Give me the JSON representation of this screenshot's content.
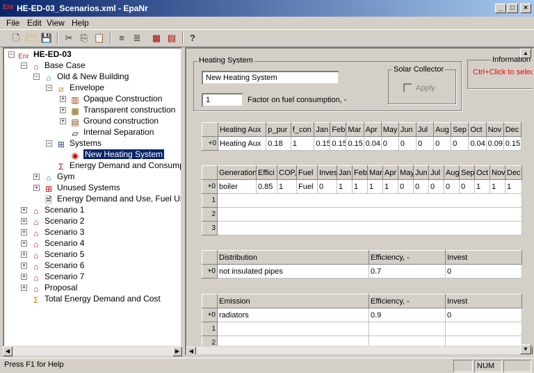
{
  "window": {
    "icon": "Enr",
    "title": "HE-ED-03_Scenarios.xml - EpaNr"
  },
  "menu": [
    "File",
    "Edit",
    "View",
    "Help"
  ],
  "tree": [
    {
      "label": "HE-ED-03",
      "icon": "Enr",
      "level": 0
    },
    {
      "label": "Base Case",
      "icon": "house-icon",
      "level": 1
    },
    {
      "label": "Old & New Building",
      "icon": "building-icon",
      "level": 2
    },
    {
      "label": "Envelope",
      "icon": "envelope-icon",
      "level": 3
    },
    {
      "label": "Opaque Construction",
      "icon": "wall-icon",
      "level": 4
    },
    {
      "label": "Transparent construction",
      "icon": "window-icon",
      "level": 4
    },
    {
      "label": "Ground construction",
      "icon": "ground-icon",
      "level": 4
    },
    {
      "label": "Internal Separation",
      "icon": "separation-icon",
      "level": 4
    },
    {
      "label": "Systems",
      "icon": "systems-icon",
      "level": 3
    },
    {
      "label": "New Heating System",
      "icon": "heating-icon",
      "level": 4
    },
    {
      "label": "Energy Demand and Consumption",
      "icon": "sum-icon",
      "level": 3
    },
    {
      "label": "Gym",
      "icon": "building-icon",
      "level": 2
    },
    {
      "label": "Unused Systems",
      "icon": "systems-icon",
      "level": 2
    },
    {
      "label": "Energy Demand and Use, Fuel Use",
      "icon": "doc-icon",
      "level": 2
    },
    {
      "label": "Scenario 1",
      "icon": "house-icon",
      "level": 1
    },
    {
      "label": "Scenario 2",
      "icon": "house-icon",
      "level": 1
    },
    {
      "label": "Scenario 3",
      "icon": "house-icon",
      "level": 1
    },
    {
      "label": "Scenario 4",
      "icon": "house-icon",
      "level": 1
    },
    {
      "label": "Scenario 5",
      "icon": "house-icon",
      "level": 1
    },
    {
      "label": "Scenario 6",
      "icon": "house-icon",
      "level": 1
    },
    {
      "label": "Scenario 7",
      "icon": "house-icon",
      "level": 1
    },
    {
      "label": "Proposal",
      "icon": "house-icon",
      "level": 1
    },
    {
      "label": "Total Energy Demand and Cost",
      "icon": "sum-icon",
      "level": 1
    }
  ],
  "heating": {
    "group_label": "Heating System",
    "name": "New Heating System",
    "factor": "1",
    "factor_label": "Factor on fuel consumption, -",
    "solar_label": "Solar Collector",
    "apply_label": "Apply",
    "info_label": "Information",
    "info_hint": "Ctrl+Click to select"
  },
  "aux": {
    "headers": [
      "Heating Aux",
      "p_pur",
      "f_con",
      "Jan",
      "Feb",
      "Mar",
      "Apr",
      "May",
      "Jun",
      "Jul",
      "Aug",
      "Sep",
      "Oct",
      "Nov",
      "Dec"
    ],
    "row_label": "+0",
    "row": [
      "Heating Aux",
      "0.18",
      "1",
      "0.15",
      "0.15",
      "0.15",
      "0.04",
      "0",
      "0",
      "0",
      "0",
      "0",
      "0.04",
      "0.09",
      "0.15"
    ]
  },
  "generation": {
    "headers": [
      "Generation",
      "Effici",
      "COP,",
      "Fuel",
      "Inves",
      "Jan",
      "Feb",
      "Mar",
      "Apr",
      "May",
      "Jun",
      "Jul",
      "Aug",
      "Sep",
      "Oct",
      "Nov",
      "Dec"
    ],
    "row_labels": [
      "+0",
      "1",
      "2",
      "3"
    ],
    "row": [
      "boiler",
      "0.85",
      "1",
      "Fuel",
      "0",
      "1",
      "1",
      "1",
      "1",
      "0",
      "0",
      "0",
      "0",
      "0",
      "1",
      "1",
      "1"
    ]
  },
  "distribution": {
    "headers": [
      "Distribution",
      "Efficiency, -",
      "Invest"
    ],
    "row_label": "+0",
    "row": [
      "not insulated pipes",
      "0.7",
      "0"
    ]
  },
  "emission": {
    "headers": [
      "Emission",
      "Efficiency, -",
      "Invest"
    ],
    "row_labels": [
      "+0",
      "1",
      "2"
    ],
    "row": [
      "radiators",
      "0.9",
      "0"
    ]
  },
  "status": {
    "help": "Press F1 for Help",
    "num": "NUM"
  }
}
